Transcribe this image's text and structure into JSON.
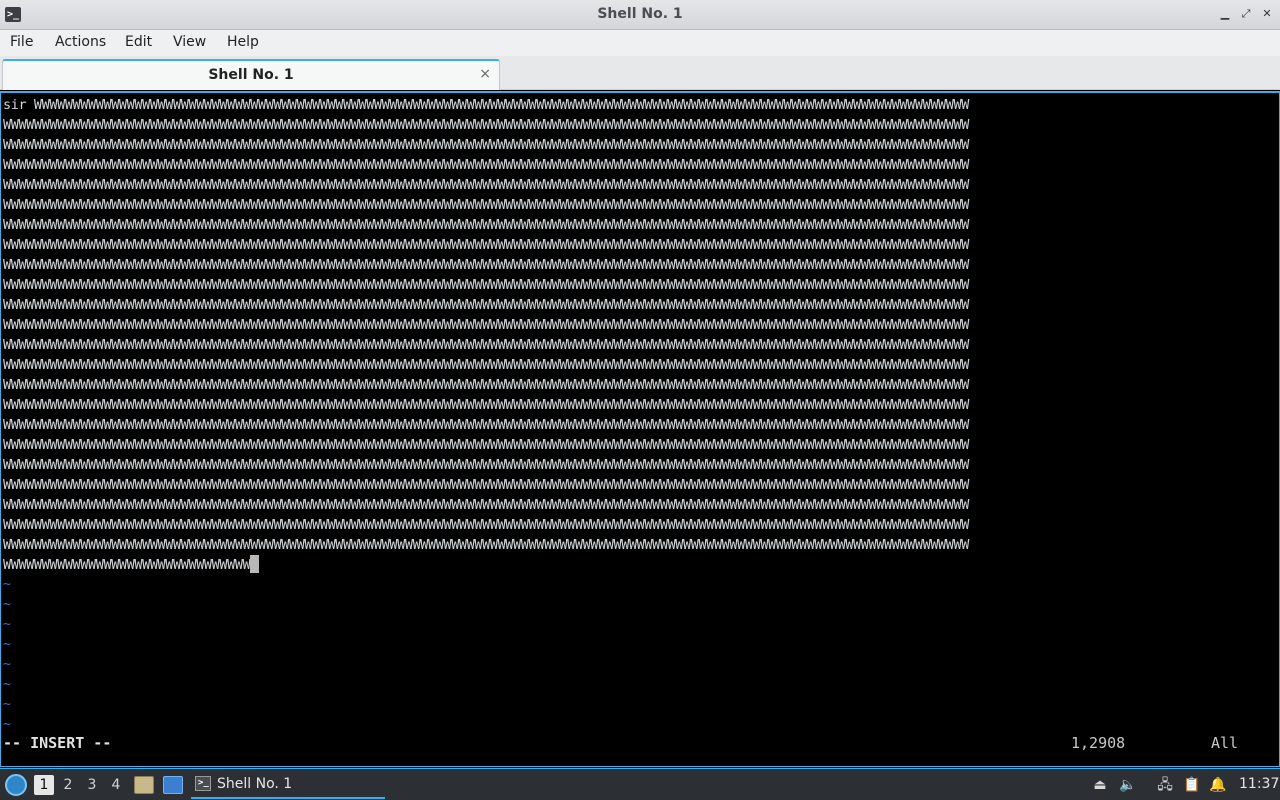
{
  "window": {
    "title": "Shell No. 1",
    "controls": {
      "minimize": "▁",
      "maximize": "⤢",
      "close": "✕"
    }
  },
  "menubar": {
    "items": [
      "File",
      "Actions",
      "Edit",
      "View",
      "Help"
    ]
  },
  "tabs": [
    {
      "label": "Shell No. 1",
      "close": "×"
    }
  ],
  "terminal": {
    "first_word": "sir",
    "line_char": "W",
    "full_lines": 23,
    "first_line_tail_len": 121,
    "last_line_len": 32,
    "tilde_count": 8,
    "tilde_char": "~",
    "mode": "-- INSERT --",
    "position": "1,2908",
    "scroll": "All"
  },
  "taskbar": {
    "desktops": [
      "1",
      "2",
      "3",
      "4"
    ],
    "active_desktop": "1",
    "task_label": "Shell No. 1",
    "clock": "11:37"
  },
  "colors": {
    "accent": "#3daee9",
    "terminal_bg": "#000000",
    "terminal_fg": "#cfd3d6",
    "tilde": "#3d6cd6",
    "taskbar_bg": "#2c3035"
  },
  "icons": {
    "app": "terminal-icon",
    "start": "start-menu-icon",
    "file_manager": "file-manager-icon",
    "desktop": "show-desktop-icon",
    "tray": [
      "eject-icon",
      "volume-icon",
      "network-icon",
      "clipboard-icon",
      "notification-icon"
    ]
  }
}
